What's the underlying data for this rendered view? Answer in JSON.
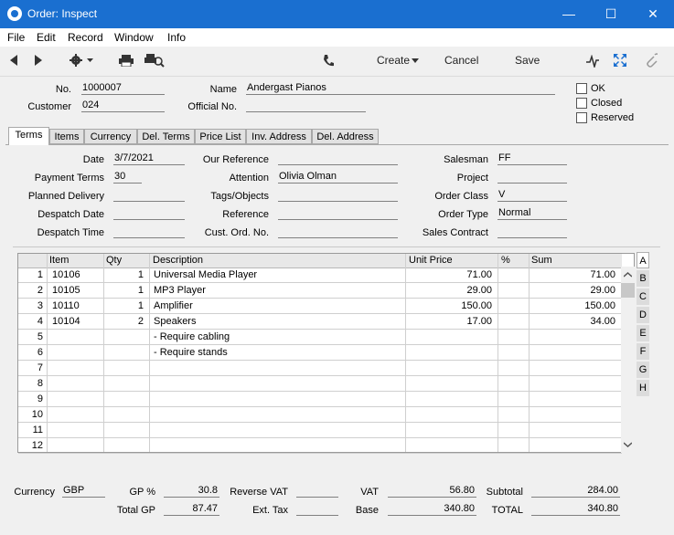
{
  "window": {
    "title": "Order: Inspect",
    "controls": {
      "minimize": "—",
      "maximize": "☐",
      "close": "✕"
    }
  },
  "menu": [
    "File",
    "Edit",
    "Record",
    "Window",
    "Info"
  ],
  "toolbar": {
    "create": "Create",
    "cancel": "Cancel",
    "save": "Save"
  },
  "header": {
    "no_label": "No.",
    "no": "1000007",
    "customer_label": "Customer",
    "customer": "024",
    "name_label": "Name",
    "name": "Andergast Pianos",
    "official_label": "Official No.",
    "official": "",
    "ok_label": "OK",
    "closed_label": "Closed",
    "reserved_label": "Reserved"
  },
  "tabs": [
    "Terms",
    "Items",
    "Currency",
    "Del. Terms",
    "Price List",
    "Inv. Address",
    "Del. Address"
  ],
  "terms": {
    "date_label": "Date",
    "date": "3/7/2021",
    "payment_terms_label": "Payment Terms",
    "payment_terms": "30",
    "planned_delivery_label": "Planned Delivery",
    "planned_delivery": "",
    "despatch_date_label": "Despatch Date",
    "despatch_date": "",
    "despatch_time_label": "Despatch Time",
    "despatch_time": "",
    "our_reference_label": "Our Reference",
    "our_reference": "",
    "attention_label": "Attention",
    "attention": "Olivia Olman",
    "tags_label": "Tags/Objects",
    "tags": "",
    "reference_label": "Reference",
    "reference": "",
    "cust_ord_label": "Cust. Ord. No.",
    "cust_ord": "",
    "salesman_label": "Salesman",
    "salesman": "FF",
    "project_label": "Project",
    "project": "",
    "order_class_label": "Order Class",
    "order_class": "V",
    "order_type_label": "Order Type",
    "order_type": "Normal",
    "sales_contract_label": "Sales Contract",
    "sales_contract": ""
  },
  "grid": {
    "columns": [
      "Item",
      "Qty",
      "Description",
      "Unit Price",
      "%",
      "Sum"
    ],
    "rows": [
      {
        "n": "1",
        "item": "10106",
        "qty": "1",
        "desc": "Universal Media Player",
        "price": "71.00",
        "pct": "",
        "sum": "71.00"
      },
      {
        "n": "2",
        "item": "10105",
        "qty": "1",
        "desc": "MP3 Player",
        "price": "29.00",
        "pct": "",
        "sum": "29.00"
      },
      {
        "n": "3",
        "item": "10110",
        "qty": "1",
        "desc": "Amplifier",
        "price": "150.00",
        "pct": "",
        "sum": "150.00"
      },
      {
        "n": "4",
        "item": "10104",
        "qty": "2",
        "desc": "Speakers",
        "price": "17.00",
        "pct": "",
        "sum": "34.00"
      },
      {
        "n": "5",
        "item": "",
        "qty": "",
        "desc": "- Require cabling",
        "price": "",
        "pct": "",
        "sum": ""
      },
      {
        "n": "6",
        "item": "",
        "qty": "",
        "desc": "- Require stands",
        "price": "",
        "pct": "",
        "sum": ""
      },
      {
        "n": "7",
        "item": "",
        "qty": "",
        "desc": "",
        "price": "",
        "pct": "",
        "sum": ""
      },
      {
        "n": "8",
        "item": "",
        "qty": "",
        "desc": "",
        "price": "",
        "pct": "",
        "sum": ""
      },
      {
        "n": "9",
        "item": "",
        "qty": "",
        "desc": "",
        "price": "",
        "pct": "",
        "sum": ""
      },
      {
        "n": "10",
        "item": "",
        "qty": "",
        "desc": "",
        "price": "",
        "pct": "",
        "sum": ""
      },
      {
        "n": "11",
        "item": "",
        "qty": "",
        "desc": "",
        "price": "",
        "pct": "",
        "sum": ""
      },
      {
        "n": "12",
        "item": "",
        "qty": "",
        "desc": "",
        "price": "",
        "pct": "",
        "sum": ""
      }
    ],
    "side_tabs": [
      "A",
      "B",
      "C",
      "D",
      "E",
      "F",
      "G",
      "H"
    ]
  },
  "footer": {
    "currency_label": "Currency",
    "currency": "GBP",
    "gp_pct_label": "GP %",
    "gp_pct": "30.8",
    "total_gp_label": "Total GP",
    "total_gp": "87.47",
    "reverse_vat_label": "Reverse VAT",
    "reverse_vat": "",
    "ext_tax_label": "Ext. Tax",
    "ext_tax": "",
    "vat_label": "VAT",
    "vat": "56.80",
    "base_label": "Base",
    "base": "340.80",
    "subtotal_label": "Subtotal",
    "subtotal": "284.00",
    "total_label": "TOTAL",
    "total": "340.80"
  }
}
